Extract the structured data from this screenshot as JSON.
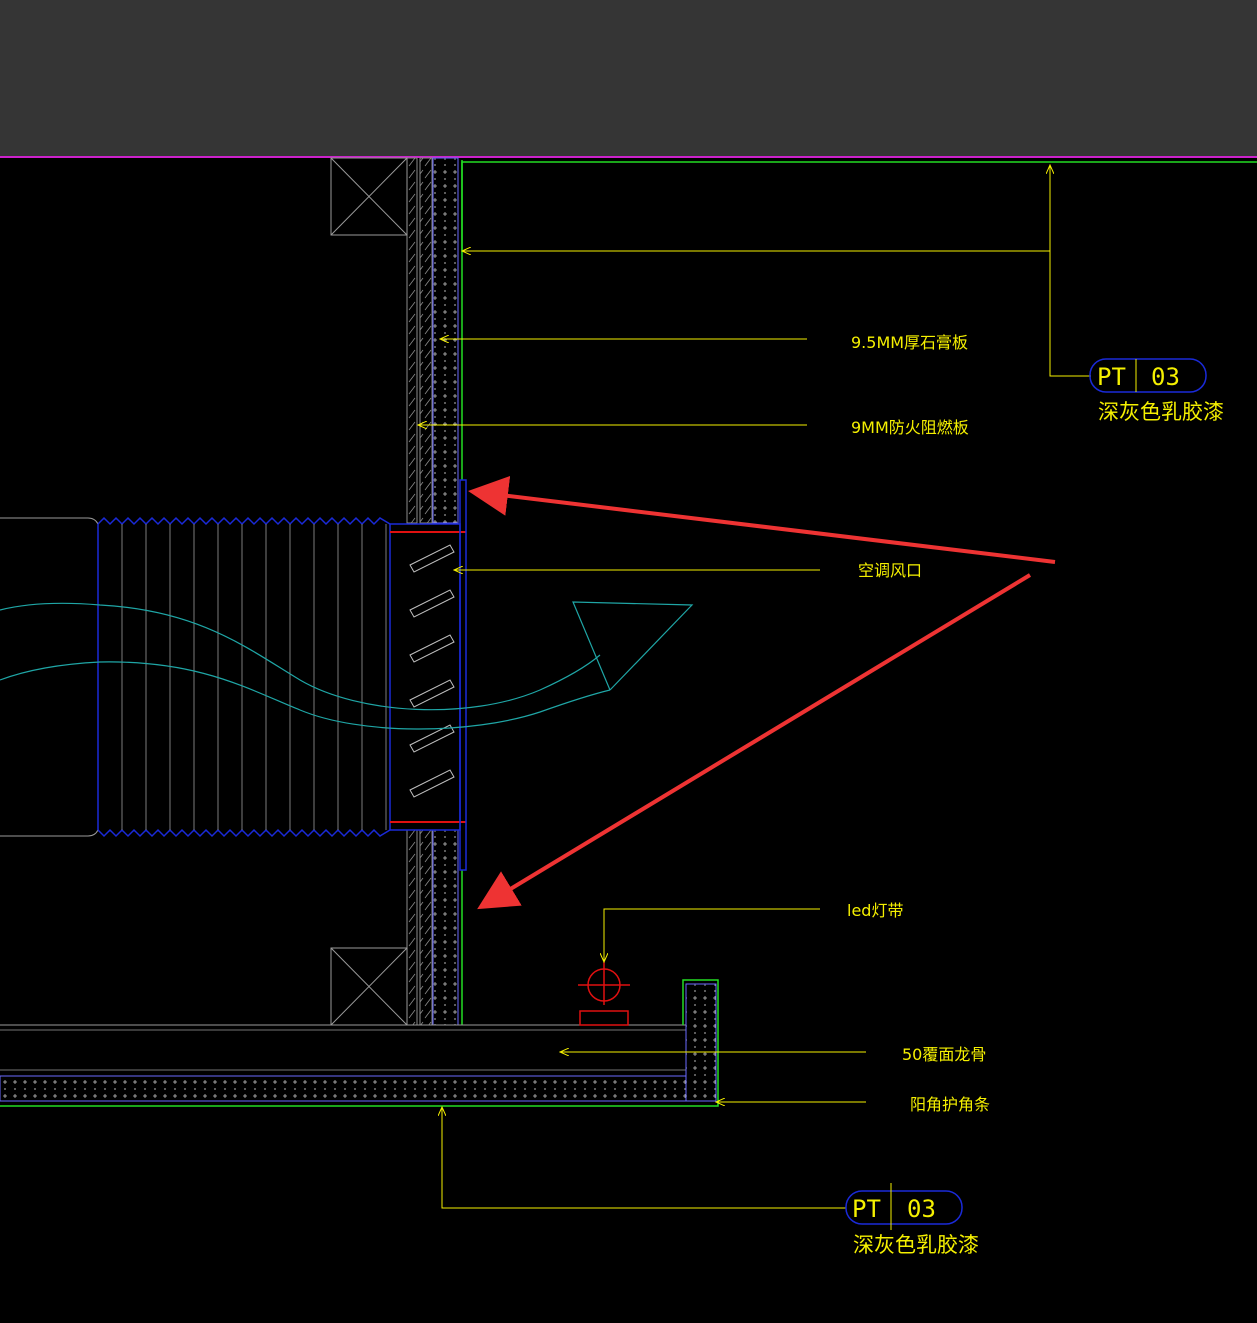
{
  "labels": {
    "gypsum": "9.5MM厚石膏板",
    "fireboard": "9MM防火阻燃板",
    "ac_vent": "空调风口",
    "led": "led灯带",
    "keel": "50覆面龙骨",
    "corner": "阳角护角条"
  },
  "tag_top": {
    "code": "PT",
    "num": "03",
    "desc": "深灰色乳胶漆"
  },
  "tag_bottom": {
    "code": "PT",
    "num": "03",
    "desc": "深灰色乳胶漆"
  },
  "colors": {
    "background": "#000000",
    "toolbar": "#353535",
    "leader": "#f5f000",
    "finish_line": "#22dd22",
    "vent_frame": "#1a2ad8",
    "airflow": "#1fa6a6",
    "gasket": "#e01010",
    "annotation_arrow": "#ee3333",
    "structure": "#9a9a9a",
    "top_border": "#cc22cc"
  }
}
